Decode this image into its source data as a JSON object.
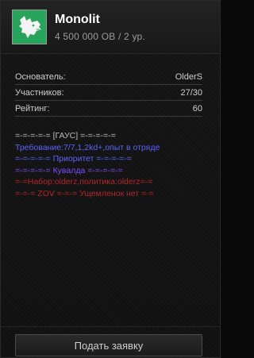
{
  "clan": {
    "name": "Monolit",
    "subtitle": "4 500 000 ОВ / 2 ур.",
    "emblem_icon": "wolf-head-icon",
    "emblem_bg": "#27a35b"
  },
  "stats": [
    {
      "label": "Основатель:",
      "value": "OlderS"
    },
    {
      "label": "Участников:",
      "value": "27/30"
    },
    {
      "label": "Рейтинг:",
      "value": "60"
    }
  ],
  "description": [
    {
      "text": "=-=-=-=-= [ГАУС] =-=-=-=-=",
      "color": "#bdbdbd"
    },
    {
      "text": "Требование:7/7,1,2kd+,опыт в отряде",
      "color": "#5b63ff"
    },
    {
      "text": "=-=-=-=-= Приоритет =-=-=-=-=",
      "color": "#5b63ff"
    },
    {
      "text": "=-=-=-=-= Кувалда =-=-=-=-=",
      "color": "#7a4dff"
    },
    {
      "text": "=-=Набор:olderz,политика:olderz=-=",
      "color": "#b3262b"
    },
    {
      "text": "=-=-= ZOV =-=-= Ущемленок нет =-=",
      "color": "#b3262b"
    }
  ],
  "apply_button": {
    "label": "Подать заявку"
  }
}
